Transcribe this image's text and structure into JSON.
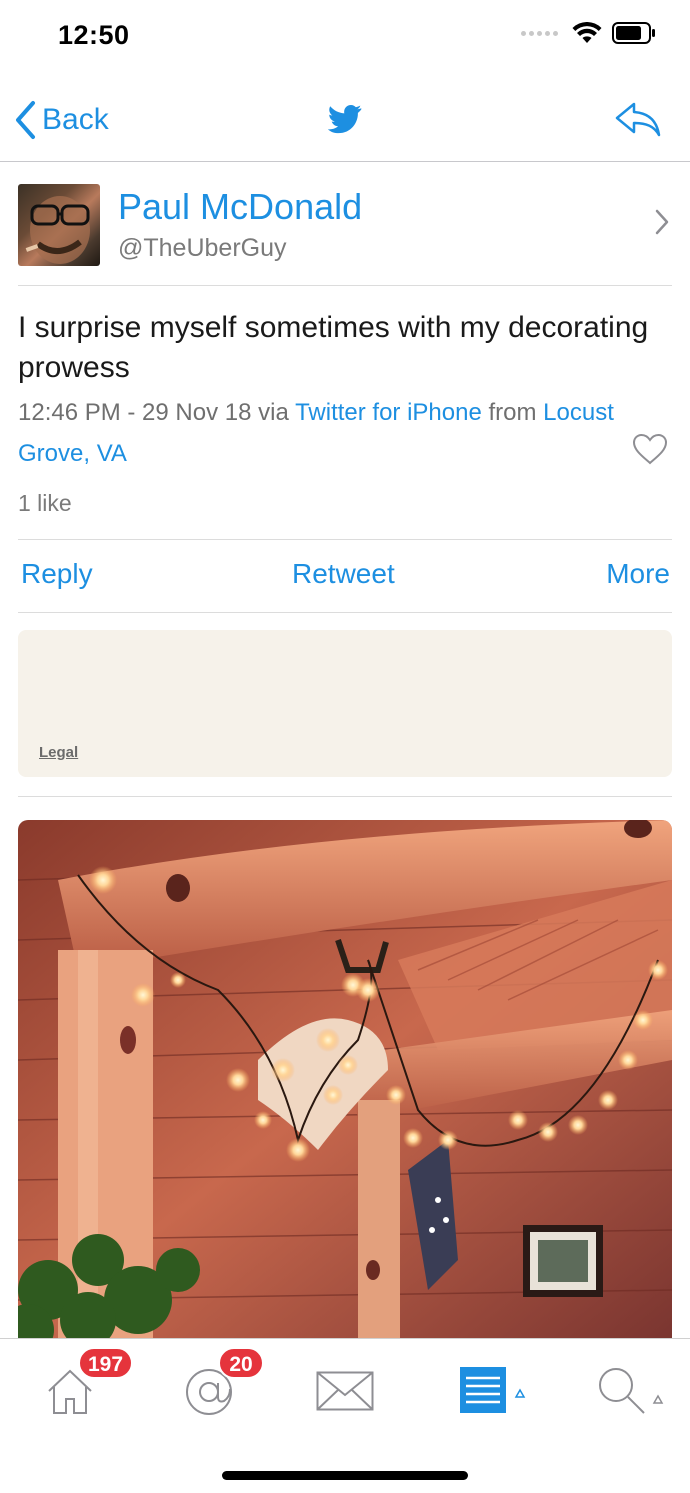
{
  "status_bar": {
    "time": "12:50"
  },
  "nav": {
    "back_label": "Back"
  },
  "profile": {
    "name": "Paul McDonald",
    "handle": "@TheUberGuy"
  },
  "tweet": {
    "text": "I surprise myself sometimes with my decorating prowess",
    "time": "12:46 PM - 29 Nov 18",
    "via_word": " via ",
    "client": "Twitter for iPhone",
    "from_word": " from ",
    "location": "Locust Grove, VA",
    "likes": "1 like"
  },
  "actions": {
    "reply": "Reply",
    "retweet": "Retweet",
    "more": "More"
  },
  "ad": {
    "legal": "Legal"
  },
  "tabs": {
    "home_badge": "197",
    "mentions_badge": "20"
  },
  "colors": {
    "accent": "#1d8fe1",
    "badge": "#e5343c",
    "ad_bg": "#f6f2ea"
  }
}
